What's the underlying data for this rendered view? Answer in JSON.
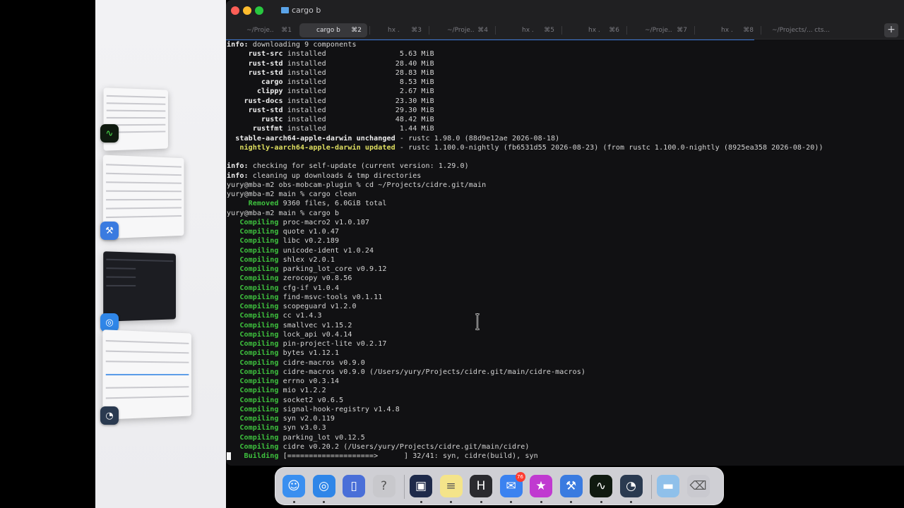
{
  "window": {
    "title": "cargo b",
    "tabs": [
      {
        "label": "~/Proje..",
        "shortcut": "⌘1",
        "active": false
      },
      {
        "label": "cargo b",
        "shortcut": "⌘2",
        "active": true
      },
      {
        "label": "hx .",
        "shortcut": "⌘3",
        "active": false
      },
      {
        "label": "~/Proje..",
        "shortcut": "⌘4",
        "active": false
      },
      {
        "label": "hx .",
        "shortcut": "⌘5",
        "active": false
      },
      {
        "label": "hx .",
        "shortcut": "⌘6",
        "active": false
      },
      {
        "label": "~/Proje..",
        "shortcut": "⌘7",
        "active": false
      },
      {
        "label": "hx .",
        "shortcut": "⌘8",
        "active": false
      },
      {
        "label": "~/Projects/...",
        "shortcut": "cts...",
        "active": false
      }
    ],
    "new_tab_label": "+"
  },
  "terminal": {
    "lines": [
      [
        {
          "t": "info:",
          "c": "b"
        },
        {
          "t": " downloading 9 components"
        }
      ],
      [
        {
          "t": "     rust-src",
          "c": "b"
        },
        {
          "t": " installed                 5.63 MiB"
        }
      ],
      [
        {
          "t": "     rust-std",
          "c": "b"
        },
        {
          "t": " installed                28.40 MiB"
        }
      ],
      [
        {
          "t": "     rust-std",
          "c": "b"
        },
        {
          "t": " installed                28.83 MiB"
        }
      ],
      [
        {
          "t": "        cargo",
          "c": "b"
        },
        {
          "t": " installed                 8.53 MiB"
        }
      ],
      [
        {
          "t": "       clippy",
          "c": "b"
        },
        {
          "t": " installed                 2.67 MiB"
        }
      ],
      [
        {
          "t": "    rust-docs",
          "c": "b"
        },
        {
          "t": " installed                23.30 MiB"
        }
      ],
      [
        {
          "t": "     rust-std",
          "c": "b"
        },
        {
          "t": " installed                29.30 MiB"
        }
      ],
      [
        {
          "t": "        rustc",
          "c": "b"
        },
        {
          "t": " installed                48.42 MiB"
        }
      ],
      [
        {
          "t": "      rustfmt",
          "c": "b"
        },
        {
          "t": " installed                 1.44 MiB"
        }
      ],
      [
        {
          "t": "  stable-aarch64-apple-darwin unchanged",
          "c": "b"
        },
        {
          "t": " - rustc 1.98.0 (88d9e12ae 2026-08-18)"
        }
      ],
      [
        {
          "t": "   nightly-aarch64-apple-darwin updated",
          "c": "y"
        },
        {
          "t": " - rustc 1.100.0-nightly (fb6531d55 2026-08-23) (from rustc 1.100.0-nightly (8925ea358 2026-08-20))"
        }
      ],
      [
        {
          "t": ""
        }
      ],
      [
        {
          "t": "info:",
          "c": "b"
        },
        {
          "t": " checking for self-update (current version: 1.29.0)"
        }
      ],
      [
        {
          "t": "info:",
          "c": "b"
        },
        {
          "t": " cleaning up downloads & tmp directories"
        }
      ],
      [
        {
          "t": "yury@mba-m2 obs-mobcam-plugin % cd ~/Projects/cidre.git/main"
        }
      ],
      [
        {
          "t": "yury@mba-m2 main % cargo clean"
        }
      ],
      [
        {
          "t": "     Removed",
          "c": "g"
        },
        {
          "t": " 9360 files, 6.0GiB total"
        }
      ],
      [
        {
          "t": "yury@mba-m2 main % cargo b"
        }
      ],
      [
        {
          "t": "   Compiling",
          "c": "g"
        },
        {
          "t": " proc-macro2 v1.0.107"
        }
      ],
      [
        {
          "t": "   Compiling",
          "c": "g"
        },
        {
          "t": " quote v1.0.47"
        }
      ],
      [
        {
          "t": "   Compiling",
          "c": "g"
        },
        {
          "t": " libc v0.2.189"
        }
      ],
      [
        {
          "t": "   Compiling",
          "c": "g"
        },
        {
          "t": " unicode-ident v1.0.24"
        }
      ],
      [
        {
          "t": "   Compiling",
          "c": "g"
        },
        {
          "t": " shlex v2.0.1"
        }
      ],
      [
        {
          "t": "   Compiling",
          "c": "g"
        },
        {
          "t": " parking_lot_core v0.9.12"
        }
      ],
      [
        {
          "t": "   Compiling",
          "c": "g"
        },
        {
          "t": " zerocopy v0.8.56"
        }
      ],
      [
        {
          "t": "   Compiling",
          "c": "g"
        },
        {
          "t": " cfg-if v1.0.4"
        }
      ],
      [
        {
          "t": "   Compiling",
          "c": "g"
        },
        {
          "t": " find-msvc-tools v0.1.11"
        }
      ],
      [
        {
          "t": "   Compiling",
          "c": "g"
        },
        {
          "t": " scopeguard v1.2.0"
        }
      ],
      [
        {
          "t": "   Compiling",
          "c": "g"
        },
        {
          "t": " cc v1.4.3"
        }
      ],
      [
        {
          "t": "   Compiling",
          "c": "g"
        },
        {
          "t": " smallvec v1.15.2"
        }
      ],
      [
        {
          "t": "   Compiling",
          "c": "g"
        },
        {
          "t": " lock_api v0.4.14"
        }
      ],
      [
        {
          "t": "   Compiling",
          "c": "g"
        },
        {
          "t": " pin-project-lite v0.2.17"
        }
      ],
      [
        {
          "t": "   Compiling",
          "c": "g"
        },
        {
          "t": " bytes v1.12.1"
        }
      ],
      [
        {
          "t": "   Compiling",
          "c": "g"
        },
        {
          "t": " cidre-macros v0.9.0"
        }
      ],
      [
        {
          "t": "   Compiling",
          "c": "g"
        },
        {
          "t": " cidre-macros v0.9.0 (/Users/yury/Projects/cidre.git/main/cidre-macros)"
        }
      ],
      [
        {
          "t": "   Compiling",
          "c": "g"
        },
        {
          "t": " errno v0.3.14"
        }
      ],
      [
        {
          "t": "   Compiling",
          "c": "g"
        },
        {
          "t": " mio v1.2.2"
        }
      ],
      [
        {
          "t": "   Compiling",
          "c": "g"
        },
        {
          "t": " socket2 v0.6.5"
        }
      ],
      [
        {
          "t": "   Compiling",
          "c": "g"
        },
        {
          "t": " signal-hook-registry v1.4.8"
        }
      ],
      [
        {
          "t": "   Compiling",
          "c": "g"
        },
        {
          "t": " syn v2.0.119"
        }
      ],
      [
        {
          "t": "   Compiling",
          "c": "g"
        },
        {
          "t": " syn v3.0.3"
        }
      ],
      [
        {
          "t": "   Compiling",
          "c": "g"
        },
        {
          "t": " parking_lot v0.12.5"
        }
      ],
      [
        {
          "t": "   Compiling",
          "c": "g"
        },
        {
          "t": " cidre v0.20.2 (/Users/yury/Projects/cidre.git/main/cidre)"
        }
      ],
      [
        {
          "t": "    Building",
          "c": "g"
        },
        {
          "t": " [====================>      ] 32/41: syn, cidre(build), syn"
        }
      ]
    ]
  },
  "stage_manager": {
    "groups": [
      {
        "app_icon": "activity-monitor-icon"
      },
      {
        "app_icon": "xcode-beta-icon"
      },
      {
        "app_icon": "safari-icon"
      },
      {
        "app_icon": "instruments-beta-icon"
      }
    ]
  },
  "dock": {
    "items": [
      {
        "name": "finder-icon",
        "glyph": "☺",
        "color": "#3a8ff0",
        "running": true
      },
      {
        "name": "safari-icon",
        "glyph": "◎",
        "color": "#2f86e8",
        "running": true
      },
      {
        "name": "simulator-icon",
        "glyph": "▯",
        "color": "#4a6fd8",
        "running": false
      },
      {
        "name": "help-icon",
        "glyph": "?",
        "color": "#c8c8cc",
        "running": false
      },
      {
        "name": "terminal-icon",
        "glyph": "▣",
        "color": "#1e2a4a",
        "running": true
      },
      {
        "name": "notes-icon",
        "glyph": "≡",
        "color": "#f4e48a",
        "running": true
      },
      {
        "name": "helix-icon",
        "glyph": "H",
        "color": "#2a2a2e",
        "running": true
      },
      {
        "name": "mail-icon",
        "glyph": "✉",
        "color": "#3b82f0",
        "running": true,
        "badge": "76"
      },
      {
        "name": "itunes-store-icon",
        "glyph": "★",
        "color": "#c03ad0",
        "running": true
      },
      {
        "name": "xcode-beta-icon",
        "glyph": "⚒",
        "color": "#3a7be0",
        "running": true
      },
      {
        "name": "activity-monitor-icon",
        "glyph": "∿",
        "color": "#101a10",
        "running": true
      },
      {
        "name": "instruments-beta-icon",
        "glyph": "◔",
        "color": "#2a3a50",
        "running": true
      },
      {
        "name": "downloads-folder-icon",
        "glyph": "▬",
        "color": "#8fc0ea",
        "running": false
      },
      {
        "name": "trash-icon",
        "glyph": "⌫",
        "color": "#c9c9cf",
        "running": false
      }
    ]
  }
}
